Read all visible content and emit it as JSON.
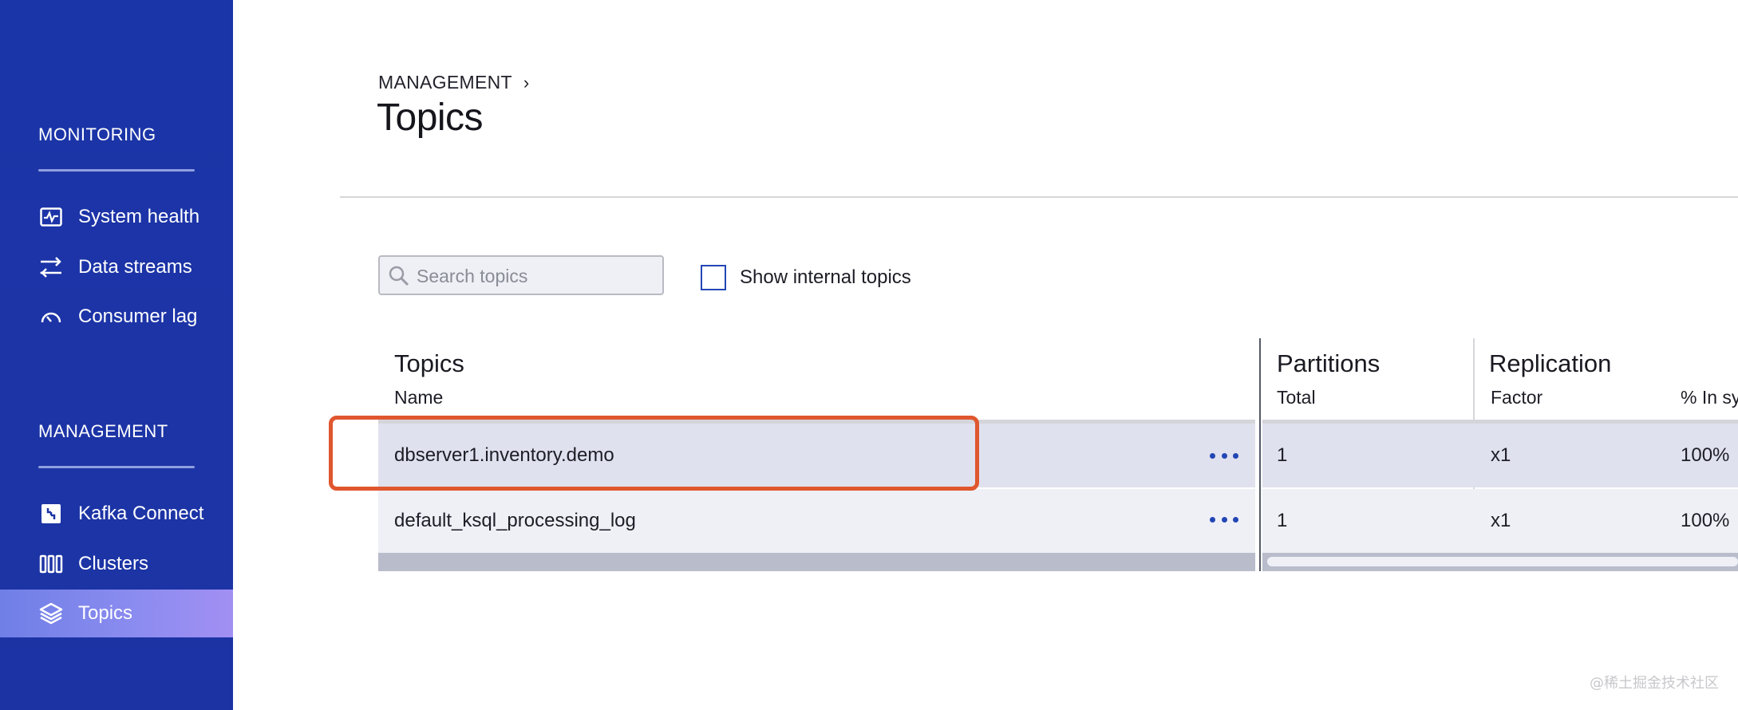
{
  "sidebar": {
    "monitoring_title": "MONITORING",
    "monitoring_items": [
      {
        "label": "System health",
        "icon": "pulse-chart-icon"
      },
      {
        "label": "Data streams",
        "icon": "arrows-exchange-icon"
      },
      {
        "label": "Consumer lag",
        "icon": "gauge-icon"
      }
    ],
    "management_title": "MANAGEMENT",
    "management_items": [
      {
        "label": "Kafka Connect",
        "icon": "connect-plug-icon"
      },
      {
        "label": "Clusters",
        "icon": "columns-icon"
      },
      {
        "label": "Topics",
        "icon": "layers-icon",
        "active": true
      }
    ],
    "colors": {
      "background": "#1b33a3",
      "active": "#8c8cf0"
    }
  },
  "header": {
    "breadcrumb": "MANAGEMENT",
    "title": "Topics"
  },
  "toolbar": {
    "search_placeholder": "Search topics",
    "search_value": "",
    "show_internal_label": "Show internal topics",
    "show_internal_checked": false
  },
  "table": {
    "groups": [
      {
        "title": "Topics",
        "columns": [
          "Name"
        ]
      },
      {
        "title": "Partitions",
        "columns": [
          "Total"
        ]
      },
      {
        "title": "Replication",
        "columns": [
          "Factor",
          "% In sy"
        ]
      }
    ],
    "rows": [
      {
        "name": "dbserver1.inventory.demo",
        "partitions": "1",
        "factor": "x1",
        "in_sync": "100%",
        "highlighted": true
      },
      {
        "name": "default_ksql_processing_log",
        "partitions": "1",
        "factor": "x1",
        "in_sync": "100%",
        "highlighted": false
      }
    ]
  },
  "colors": {
    "accent": "#2346b5",
    "highlight_border": "#e0562e"
  },
  "watermark": "@稀土掘金技术社区"
}
